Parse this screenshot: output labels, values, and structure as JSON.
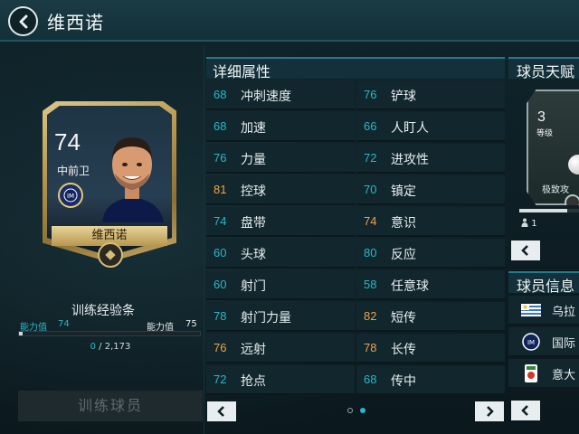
{
  "header": {
    "title": "维西诺"
  },
  "player_card": {
    "rating": "74",
    "position": "中前卫",
    "name": "维西诺"
  },
  "training": {
    "title": "训练经验条",
    "left_label": "能力值",
    "left_value": "74",
    "right_label": "能力值",
    "right_value": "75",
    "progress_fraction": 0.02,
    "current": "0",
    "separator": "/",
    "total": "2,173",
    "button_label": "训练球员"
  },
  "attributes": {
    "title": "详细属性",
    "rows": [
      {
        "left": {
          "value": "68",
          "name": "冲刺速度",
          "color": "#28b9c9"
        },
        "right": {
          "value": "76",
          "name": "铲球",
          "color": "#28b9c9"
        }
      },
      {
        "left": {
          "value": "68",
          "name": "加速",
          "color": "#28b9c9"
        },
        "right": {
          "value": "66",
          "name": "人盯人",
          "color": "#28b9c9"
        }
      },
      {
        "left": {
          "value": "76",
          "name": "力量",
          "color": "#28b9c9"
        },
        "right": {
          "value": "72",
          "name": "进攻性",
          "color": "#28b9c9"
        }
      },
      {
        "left": {
          "value": "81",
          "name": "控球",
          "color": "#f0a24a"
        },
        "right": {
          "value": "70",
          "name": "镇定",
          "color": "#28b9c9"
        }
      },
      {
        "left": {
          "value": "74",
          "name": "盘带",
          "color": "#28b9c9"
        },
        "right": {
          "value": "74",
          "name": "意识",
          "color": "#f0a24a"
        }
      },
      {
        "left": {
          "value": "60",
          "name": "头球",
          "color": "#28b9c9"
        },
        "right": {
          "value": "80",
          "name": "反应",
          "color": "#28b9c9"
        }
      },
      {
        "left": {
          "value": "60",
          "name": "射门",
          "color": "#28b9c9"
        },
        "right": {
          "value": "58",
          "name": "任意球",
          "color": "#28b9c9"
        }
      },
      {
        "left": {
          "value": "78",
          "name": "射门力量",
          "color": "#28b9c9"
        },
        "right": {
          "value": "82",
          "name": "短传",
          "color": "#f0a24a"
        }
      },
      {
        "left": {
          "value": "76",
          "name": "远射",
          "color": "#f0a24a"
        },
        "right": {
          "value": "78",
          "name": "长传",
          "color": "#f0a24a"
        }
      },
      {
        "left": {
          "value": "72",
          "name": "抢点",
          "color": "#28b9c9"
        },
        "right": {
          "value": "68",
          "name": "传中",
          "color": "#28b9c9"
        }
      }
    ],
    "page_count": 2,
    "active_page": 1
  },
  "talent": {
    "title": "球员天赋",
    "level": "3",
    "level_label": "等级",
    "name": "极致攻",
    "progress_fraction": 0.8,
    "count": "1"
  },
  "player_info": {
    "title": "球员信息",
    "items": [
      {
        "icon": "uruguay-flag-icon",
        "text": "乌拉"
      },
      {
        "icon": "inter-club-icon",
        "text": "国际"
      },
      {
        "icon": "serie-a-league-icon",
        "text": "意大"
      }
    ]
  },
  "colors": {
    "accent": "#28b9c9",
    "highlight": "#f0a24a",
    "gold": "#c9ae6a"
  }
}
